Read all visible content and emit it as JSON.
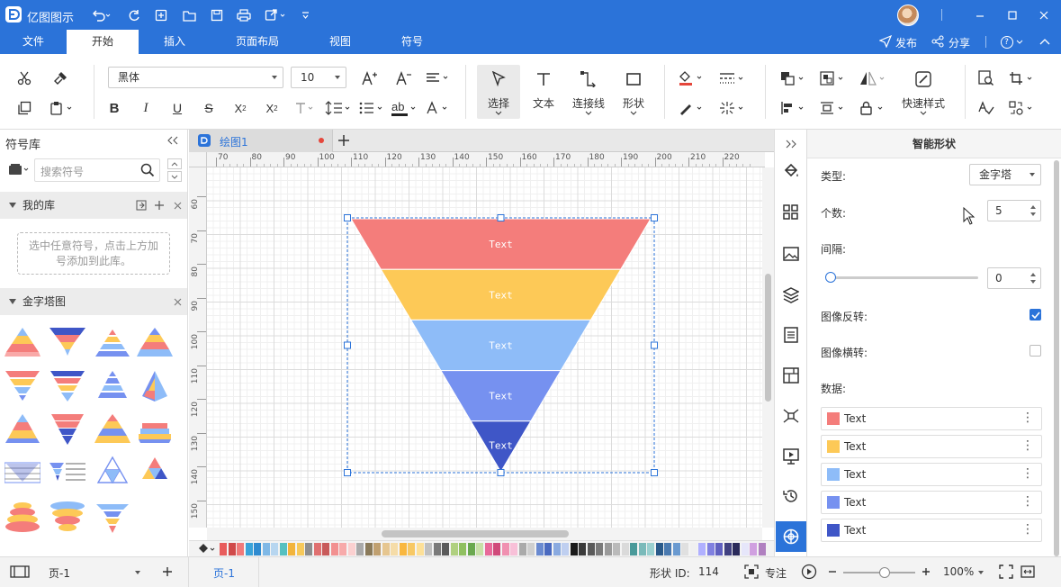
{
  "app": {
    "title": "亿图图示",
    "brand_color": "#2b73d9"
  },
  "menu": {
    "tabs": [
      "文件",
      "开始",
      "插入",
      "页面布局",
      "视图",
      "符号"
    ],
    "active": "开始"
  },
  "menu_right": {
    "publish": "发布",
    "share": "分享",
    "help": "?"
  },
  "ribbon": {
    "font_family": "黑体",
    "font_size": "10",
    "select_label": "选择",
    "text_label": "文本",
    "connector_label": "连接线",
    "shape_label": "形状",
    "quick_style_label": "快速样式"
  },
  "left_panel": {
    "title": "符号库",
    "search_placeholder": "搜索符号",
    "my_library": "我的库",
    "my_library_hint": "选中任意符号，点击上方加号添加到此库。",
    "pyramid_section": "金字塔图"
  },
  "canvas": {
    "tab_name": "绘图1",
    "ruler_top": [
      "70",
      "80",
      "90",
      "100",
      "110",
      "120",
      "130",
      "140",
      "150",
      "160",
      "170",
      "180",
      "190",
      "200",
      "210",
      "220"
    ],
    "ruler_left": [
      "60",
      "70",
      "80",
      "90",
      "100",
      "110",
      "120",
      "130",
      "140",
      "150"
    ]
  },
  "pyramid": {
    "levels": [
      {
        "label": "Text",
        "color": "#f47d7b"
      },
      {
        "label": "Text",
        "color": "#fdc957"
      },
      {
        "label": "Text",
        "color": "#8ebcf8"
      },
      {
        "label": "Text",
        "color": "#7691f0"
      },
      {
        "label": "Text",
        "color": "#3f56c7"
      }
    ]
  },
  "right_panel": {
    "title": "智能形状",
    "type_label": "类型:",
    "type_value": "金字塔",
    "count_label": "个数:",
    "count_value": "5",
    "gap_label": "间隔:",
    "gap_value": "0",
    "gap_slider_value": 0,
    "flip_label": "图像反转:",
    "flip_checked": true,
    "mirror_label": "图像横转:",
    "mirror_checked": false,
    "data_label": "数据:",
    "data_items": [
      {
        "text": "Text",
        "color": "#f47d7b"
      },
      {
        "text": "Text",
        "color": "#fdc957"
      },
      {
        "text": "Text",
        "color": "#8ebcf8"
      },
      {
        "text": "Text",
        "color": "#7691f0"
      },
      {
        "text": "Text",
        "color": "#3f56c7"
      }
    ]
  },
  "status": {
    "page_select": "页-1",
    "page_tab": "页-1",
    "shape_id_label": "形状 ID:",
    "shape_id": "114",
    "focus_label": "专注",
    "zoom": "100%",
    "zoom_level": 0.5
  }
}
